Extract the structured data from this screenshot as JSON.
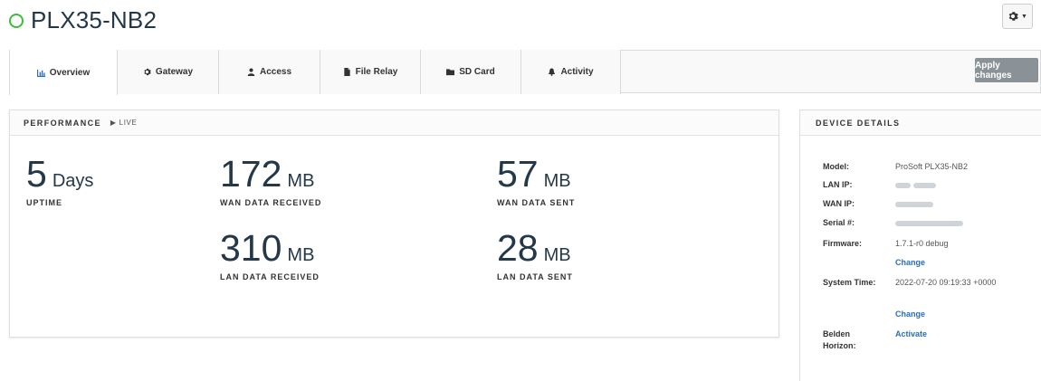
{
  "header": {
    "title": "PLX35-NB2",
    "status_color": "#3dbb3d",
    "settings_icon": "gear-icon"
  },
  "tabs": [
    {
      "label": "Overview",
      "icon": "bar-chart-icon",
      "active": true
    },
    {
      "label": "Gateway",
      "icon": "gear-icon",
      "active": false
    },
    {
      "label": "Access",
      "icon": "user-icon",
      "active": false
    },
    {
      "label": "File Relay",
      "icon": "file-icon",
      "active": false
    },
    {
      "label": "SD Card",
      "icon": "folder-icon",
      "active": false
    },
    {
      "label": "Activity",
      "icon": "bell-icon",
      "active": false
    }
  ],
  "toolbar": {
    "apply_label": "Apply changes"
  },
  "performance": {
    "title": "PERFORMANCE",
    "live_label": "LIVE",
    "uptime": {
      "value": "5",
      "unit": "Days",
      "label": "UPTIME"
    },
    "wan_received": {
      "value": "172",
      "unit": "MB",
      "label": "WAN DATA RECEIVED"
    },
    "wan_sent": {
      "value": "57",
      "unit": "MB",
      "label": "WAN DATA SENT"
    },
    "lan_received": {
      "value": "310",
      "unit": "MB",
      "label": "LAN DATA RECEIVED"
    },
    "lan_sent": {
      "value": "28",
      "unit": "MB",
      "label": "LAN DATA SENT"
    }
  },
  "details": {
    "title": "DEVICE DETAILS",
    "model_label": "Model:",
    "model_value": "ProSoft PLX35-NB2",
    "lan_ip_label": "LAN IP:",
    "wan_ip_label": "WAN IP:",
    "serial_label": "Serial #:",
    "firmware_label": "Firmware:",
    "firmware_value": "1.7.1-r0 debug",
    "firmware_change": "Change",
    "system_time_label": "System Time:",
    "system_time_value": "2022-07-20 09:19:33 +0000",
    "system_time_change": "Change",
    "horizon_label": "Belden Horizon:",
    "horizon_action": "Activate"
  },
  "colors": {
    "accent_link": "#2a6ebb",
    "apply_button": "#8a9298",
    "title_text": "#24384a"
  }
}
